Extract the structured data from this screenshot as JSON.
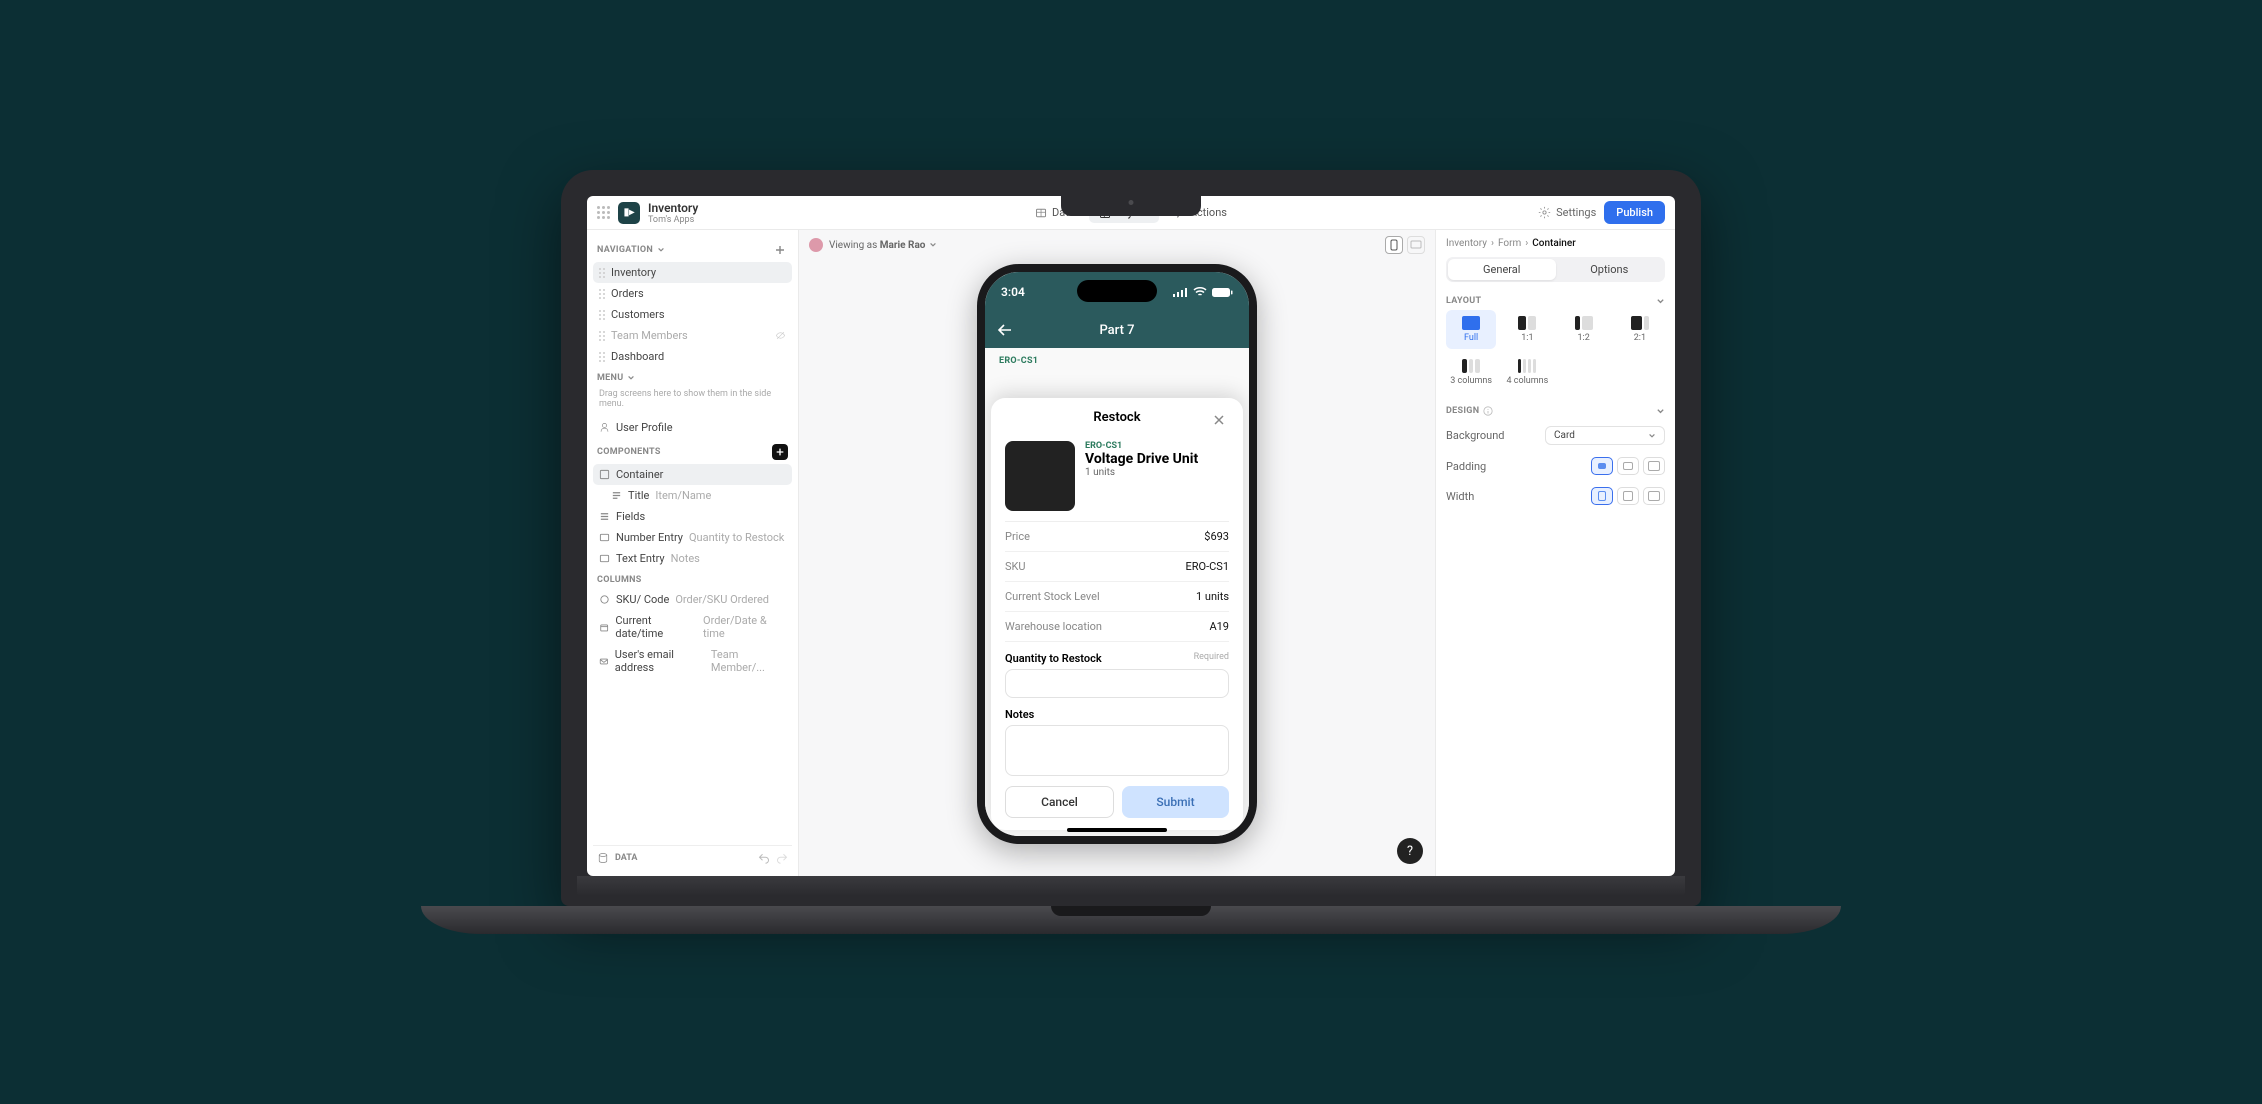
{
  "app": {
    "title": "Inventory",
    "subtitle": "Tom's Apps"
  },
  "topbar": {
    "tabs": {
      "data": "Data",
      "layout": "Layout",
      "actions": "Actions"
    },
    "settings": "Settings",
    "publish": "Publish"
  },
  "left": {
    "navigation_hdr": "NAVIGATION",
    "nav_items": [
      "Inventory",
      "Orders",
      "Customers",
      "Team Members",
      "Dashboard"
    ],
    "menu_hdr": "MENU",
    "menu_hint": "Drag screens here to show them in the side menu.",
    "user_profile": "User Profile",
    "components_hdr": "COMPONENTS",
    "components": [
      {
        "label": "Container",
        "detail": ""
      },
      {
        "label": "Title",
        "detail": "Item/Name"
      },
      {
        "label": "Fields",
        "detail": ""
      },
      {
        "label": "Number Entry",
        "detail": "Quantity to Restock"
      },
      {
        "label": "Text Entry",
        "detail": "Notes"
      }
    ],
    "columns_hdr": "COLUMNS",
    "columns": [
      {
        "label": "SKU/ Code",
        "detail": "Order/SKU Ordered"
      },
      {
        "label": "Current date/time",
        "detail": "Order/Date & time"
      },
      {
        "label": "User's email address",
        "detail": "Team Member/..."
      }
    ],
    "data_footer": "DATA"
  },
  "center": {
    "viewing_as_prefix": "Viewing as ",
    "viewing_as_name": "Marie Rao"
  },
  "phone": {
    "time": "3:04",
    "screen_title": "Part 7",
    "header_sku": "ERO-CS1",
    "sheet_title": "Restock",
    "item": {
      "sku": "ERO-CS1",
      "name": "Voltage Drive Unit",
      "units": "1 units"
    },
    "rows": {
      "price_k": "Price",
      "price_v": "$693",
      "sku_k": "SKU",
      "sku_v": "ERO-CS1",
      "stock_k": "Current Stock Level",
      "stock_v": "1 units",
      "loc_k": "Warehouse location",
      "loc_v": "A19"
    },
    "qty_label": "Quantity to Restock",
    "required": "Required",
    "notes_label": "Notes",
    "cancel": "Cancel",
    "submit": "Submit"
  },
  "right": {
    "crumbs": {
      "a": "Inventory",
      "b": "Form",
      "c": "Container"
    },
    "tabs": {
      "general": "General",
      "options": "Options"
    },
    "layout_hdr": "LAYOUT",
    "layouts": [
      "Full",
      "1:1",
      "1:2",
      "2:1",
      "3 columns",
      "4 columns"
    ],
    "design_hdr": "DESIGN",
    "background_lbl": "Background",
    "background_val": "Card",
    "padding_lbl": "Padding",
    "width_lbl": "Width"
  }
}
